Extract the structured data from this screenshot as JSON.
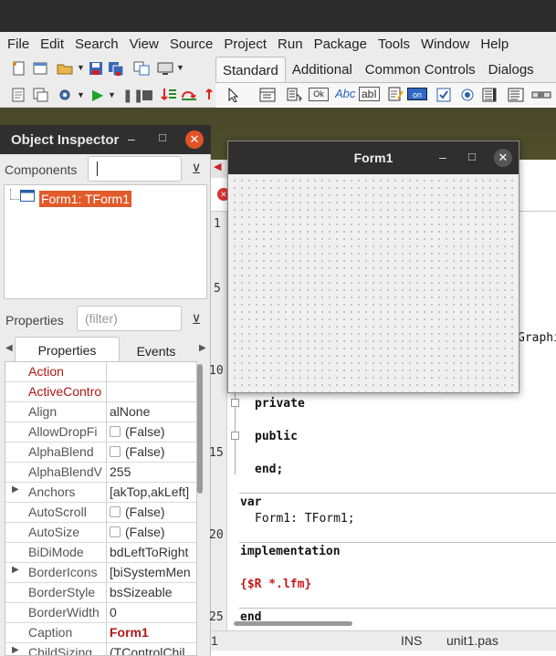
{
  "menubar": [
    "File",
    "Edit",
    "Search",
    "View",
    "Source",
    "Project",
    "Run",
    "Package",
    "Tools",
    "Window",
    "Help"
  ],
  "palette": {
    "tabs": [
      "Standard",
      "Additional",
      "Common Controls",
      "Dialogs"
    ],
    "components": [
      "pointer",
      "TMainMenu",
      "TPopupMenu",
      "TButton",
      "TLabel",
      "TEdit",
      "TMemo",
      "TToggleBox",
      "TCheckBox",
      "TRadioButton",
      "TListBox",
      "TComboBox",
      "TScrollBar"
    ],
    "button_text": {
      "ok": "Ok",
      "abc": "Abc",
      "abi": "abI",
      "on": "on"
    }
  },
  "object_inspector": {
    "title": "Object Inspector",
    "components_label": "Components",
    "properties_label": "Properties",
    "filter_placeholder": "(filter)",
    "tree_node": "Form1: TForm1",
    "tabs": [
      "Properties",
      "Events"
    ],
    "rows": [
      {
        "name": "Action",
        "value": "",
        "style": "red"
      },
      {
        "name": "ActiveContro",
        "value": "",
        "style": "red"
      },
      {
        "name": "Align",
        "value": "alNone"
      },
      {
        "name": "AllowDropFi",
        "value": "(False)",
        "check": true
      },
      {
        "name": "AlphaBlend",
        "value": "(False)",
        "check": true
      },
      {
        "name": "AlphaBlendV",
        "value": "255"
      },
      {
        "name": "Anchors",
        "value": "[akTop,akLeft]",
        "expand": true
      },
      {
        "name": "AutoScroll",
        "value": "(False)",
        "check": true
      },
      {
        "name": "AutoSize",
        "value": "(False)",
        "check": true
      },
      {
        "name": "BiDiMode",
        "value": "bdLeftToRight"
      },
      {
        "name": "BorderIcons",
        "value": "[biSystemMen",
        "expand": true
      },
      {
        "name": "BorderStyle",
        "value": "bsSizeable"
      },
      {
        "name": "BorderWidth",
        "value": "0"
      },
      {
        "name": "Caption",
        "value": "Form1",
        "style": "boldvalue"
      },
      {
        "name": "ChildSizing",
        "value": "(TControlChil",
        "expand": true
      }
    ]
  },
  "form1": {
    "title": "Form1"
  },
  "editor": {
    "line_numbers": [
      "1",
      "5",
      "10",
      "15",
      "20",
      "25"
    ],
    "lines": [
      {
        "text": "private",
        "cls": "kw"
      },
      {
        "text": "public",
        "cls": "kw"
      },
      {
        "text": "end;",
        "cls": "mixed"
      },
      {
        "text": "var",
        "cls": "kw"
      },
      {
        "text": "Form1: TForm1;",
        "cls": "plain"
      },
      {
        "text": "implementation",
        "cls": "kw"
      },
      {
        "text": "{$R *.lfm}",
        "cls": "dir"
      },
      {
        "text": "end",
        "cls": "kw"
      }
    ],
    "partial_text": "Graphi"
  },
  "statusbar": {
    "line": "1",
    "mode": "INS",
    "file": "unit1.pas"
  },
  "colors": {
    "accent": "#e15b2a",
    "titlebar": "#2f2f2f",
    "property_red": "#b01717"
  }
}
